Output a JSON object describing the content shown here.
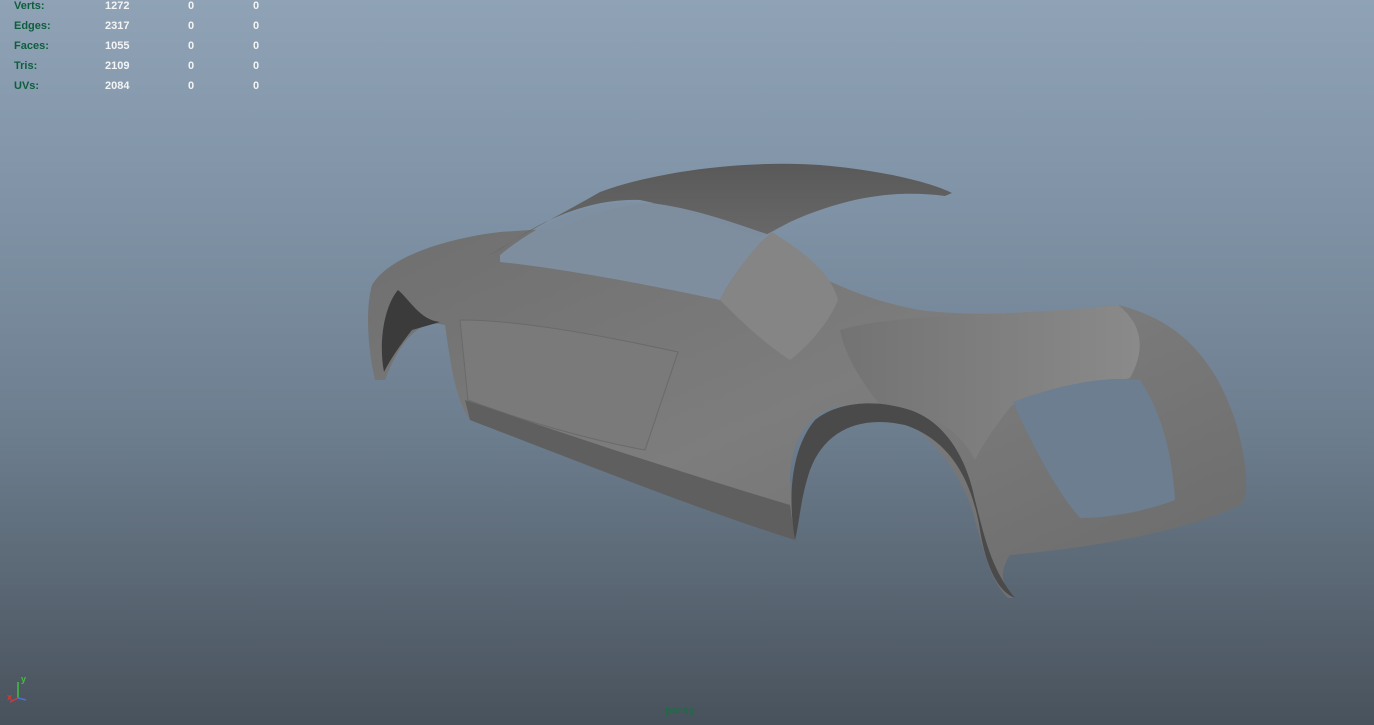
{
  "hud": {
    "rows": [
      {
        "label": "Verts:",
        "total": "1272",
        "selected": "0",
        "extra": "0"
      },
      {
        "label": "Edges:",
        "total": "2317",
        "selected": "0",
        "extra": "0"
      },
      {
        "label": "Faces:",
        "total": "1055",
        "selected": "0",
        "extra": "0"
      },
      {
        "label": "Tris:",
        "total": "2109",
        "selected": "0",
        "extra": "0"
      },
      {
        "label": "UVs:",
        "total": "2084",
        "selected": "0",
        "extra": "0"
      }
    ]
  },
  "viewport": {
    "camera_name": "persp",
    "axis_labels": {
      "y": "y",
      "x": "x"
    }
  },
  "colors": {
    "hud_label": "#0e5e3d",
    "hud_value": "#f4f4f4",
    "camera_label": "#1f6b45",
    "model_surface": "#7a7a7a"
  },
  "icons": [
    "axis-gizmo-icon"
  ]
}
